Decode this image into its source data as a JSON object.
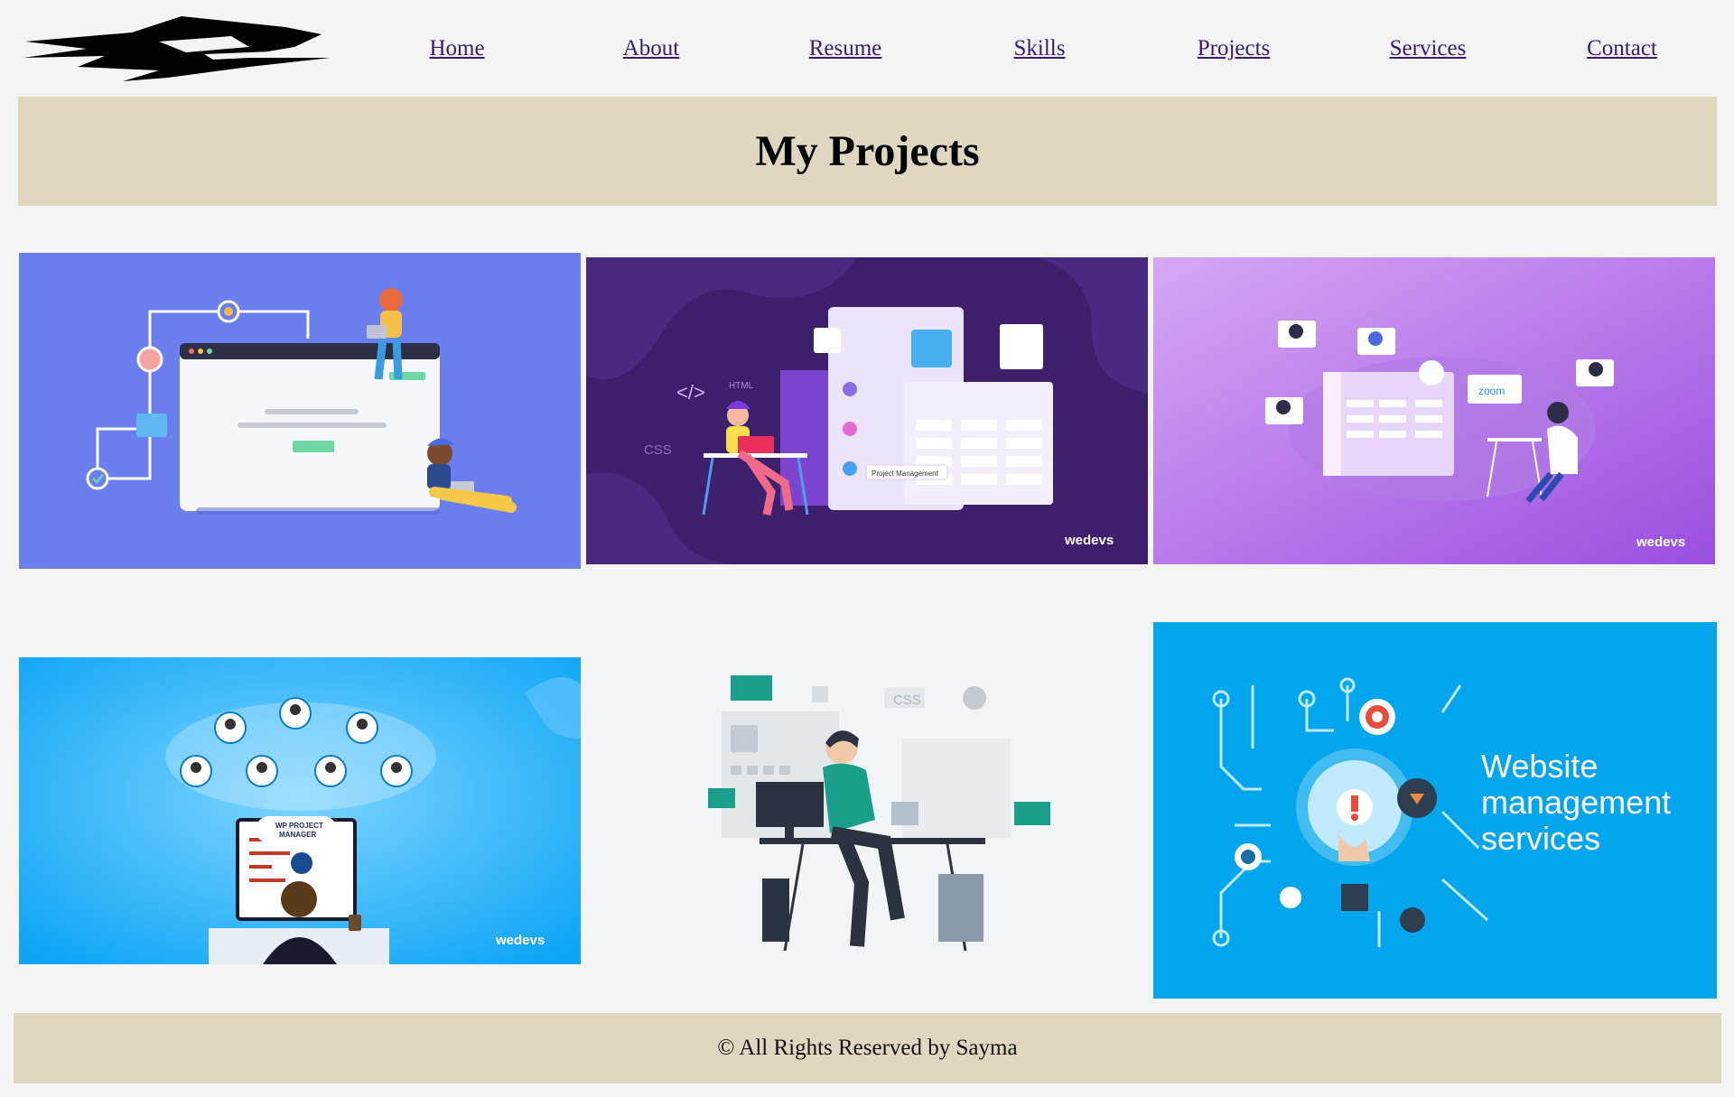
{
  "nav": {
    "items": [
      "Home",
      "About",
      "Resume",
      "Skills",
      "Projects",
      "Services",
      "Contact"
    ]
  },
  "banner": {
    "title": "My Projects"
  },
  "projects": {
    "p1": {},
    "p2": {
      "html_tag": "</>",
      "html_label": "HTML",
      "css_label": "CSS",
      "board_label": "Project Management",
      "brand": "wedevs"
    },
    "p3": {
      "zoom_label": "zoom",
      "brand": "wedevs"
    },
    "p4": {
      "badge_line1": "WP PROJECT",
      "badge_line2": "MANAGER",
      "brand": "wedevs"
    },
    "p5": {
      "css_label": "CSS"
    },
    "p6": {
      "line1": "Website",
      "line2": "management",
      "line3": "services"
    }
  },
  "footer": {
    "text": "© All Rights Reserved by Sayma"
  },
  "colors": {
    "banner_bg": "#dfd7c0",
    "page_bg": "#f4f4f4",
    "link": "#3b1a6d"
  }
}
